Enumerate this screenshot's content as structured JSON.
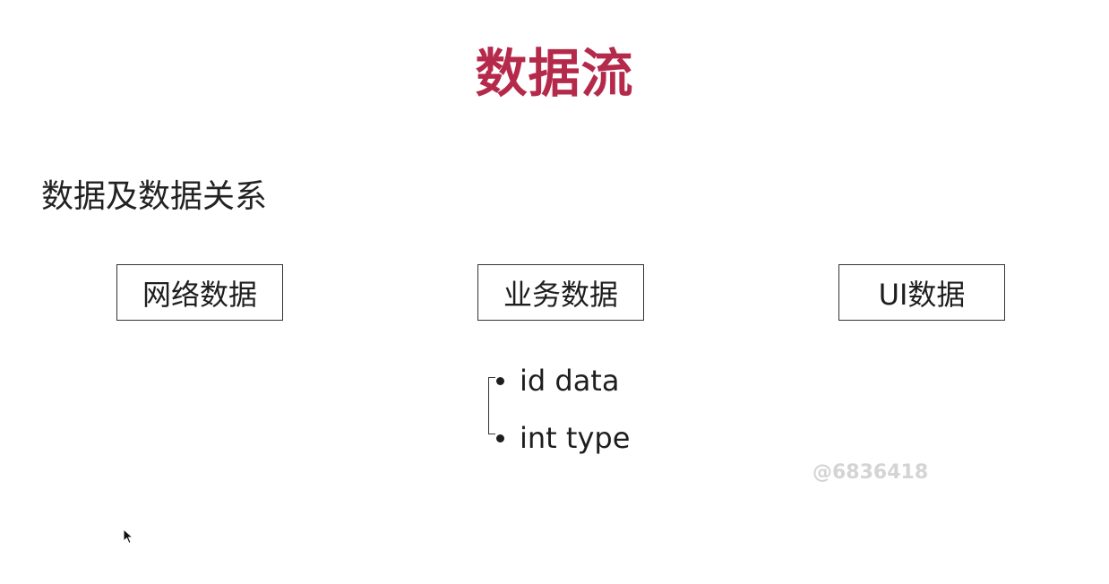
{
  "title": "数据流",
  "subtitle": "数据及数据关系",
  "boxes": {
    "network": "网络数据",
    "business": "业务数据",
    "ui": "UI数据"
  },
  "business_fields": [
    "id data",
    "int type"
  ],
  "watermark": "@6836418",
  "colors": {
    "title": "#b5294a",
    "text": "#1e1e1e",
    "watermark": "#d4d4d4"
  }
}
